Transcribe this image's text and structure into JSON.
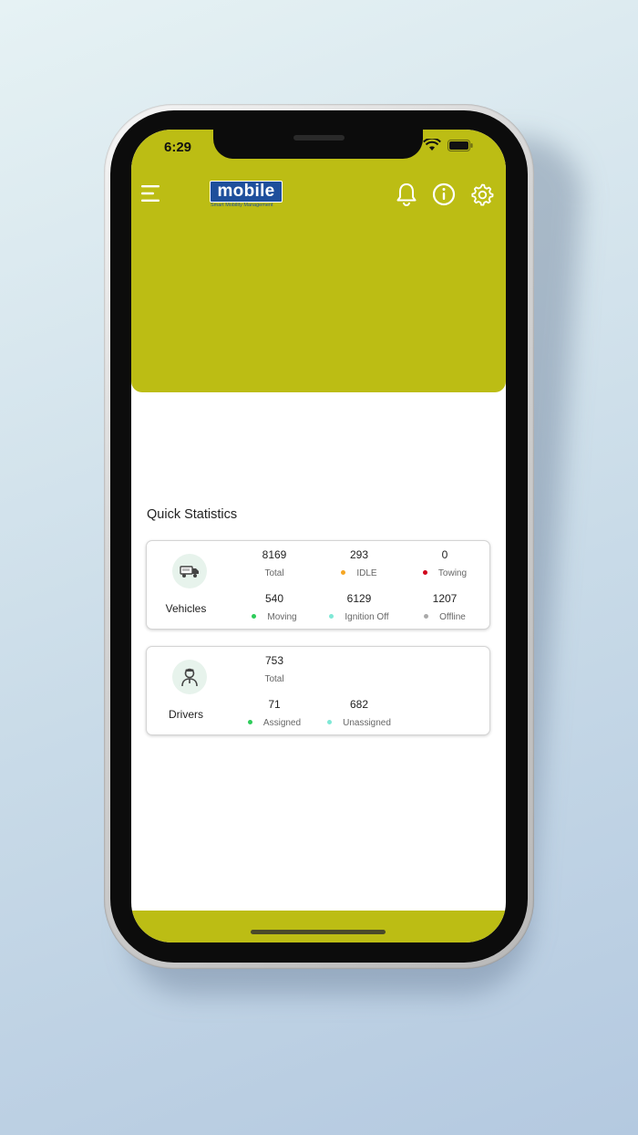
{
  "status_bar": {
    "time": "6:29"
  },
  "header": {
    "logo_text": "mobile",
    "logo_tagline": "Smart Mobility Management",
    "accent_color": "#bcbd14",
    "icons": [
      "menu-icon",
      "bell-icon",
      "info-icon",
      "gear-icon"
    ]
  },
  "quick_stats": {
    "title": "Quick Statistics",
    "vehicles": {
      "label": "Vehicles",
      "icon": "truck-icon",
      "stats": [
        {
          "value": "8169",
          "label": "Total",
          "dot": ""
        },
        {
          "value": "293",
          "label": "IDLE",
          "dot": "#f5a623"
        },
        {
          "value": "0",
          "label": "Towing",
          "dot": "#d0021b"
        },
        {
          "value": "540",
          "label": "Moving",
          "dot": "#2ecc5a"
        },
        {
          "value": "6129",
          "label": "Ignition Off",
          "dot": "#7fe8d6"
        },
        {
          "value": "1207",
          "label": "Offline",
          "dot": "#aaaaaa"
        }
      ]
    },
    "drivers": {
      "label": "Drivers",
      "icon": "driver-icon",
      "stats": [
        {
          "value": "753",
          "label": "Total",
          "dot": ""
        },
        {
          "value": "71",
          "label": "Assigned",
          "dot": "#2ecc5a"
        },
        {
          "value": "682",
          "label": "Unassigned",
          "dot": "#7fe8d6"
        }
      ]
    }
  }
}
